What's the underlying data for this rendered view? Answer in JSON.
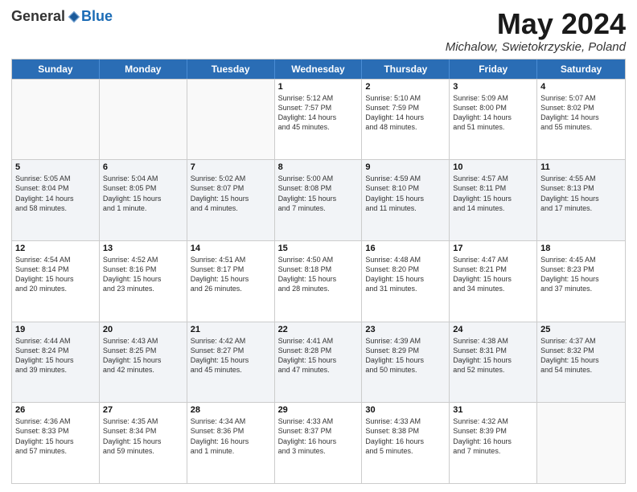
{
  "logo": {
    "general": "General",
    "blue": "Blue"
  },
  "header": {
    "month": "May 2024",
    "location": "Michalow, Swietokrzyskie, Poland"
  },
  "days": [
    "Sunday",
    "Monday",
    "Tuesday",
    "Wednesday",
    "Thursday",
    "Friday",
    "Saturday"
  ],
  "rows": [
    [
      {
        "day": "",
        "info": ""
      },
      {
        "day": "",
        "info": ""
      },
      {
        "day": "",
        "info": ""
      },
      {
        "day": "1",
        "info": "Sunrise: 5:12 AM\nSunset: 7:57 PM\nDaylight: 14 hours\nand 45 minutes."
      },
      {
        "day": "2",
        "info": "Sunrise: 5:10 AM\nSunset: 7:59 PM\nDaylight: 14 hours\nand 48 minutes."
      },
      {
        "day": "3",
        "info": "Sunrise: 5:09 AM\nSunset: 8:00 PM\nDaylight: 14 hours\nand 51 minutes."
      },
      {
        "day": "4",
        "info": "Sunrise: 5:07 AM\nSunset: 8:02 PM\nDaylight: 14 hours\nand 55 minutes."
      }
    ],
    [
      {
        "day": "5",
        "info": "Sunrise: 5:05 AM\nSunset: 8:04 PM\nDaylight: 14 hours\nand 58 minutes."
      },
      {
        "day": "6",
        "info": "Sunrise: 5:04 AM\nSunset: 8:05 PM\nDaylight: 15 hours\nand 1 minute."
      },
      {
        "day": "7",
        "info": "Sunrise: 5:02 AM\nSunset: 8:07 PM\nDaylight: 15 hours\nand 4 minutes."
      },
      {
        "day": "8",
        "info": "Sunrise: 5:00 AM\nSunset: 8:08 PM\nDaylight: 15 hours\nand 7 minutes."
      },
      {
        "day": "9",
        "info": "Sunrise: 4:59 AM\nSunset: 8:10 PM\nDaylight: 15 hours\nand 11 minutes."
      },
      {
        "day": "10",
        "info": "Sunrise: 4:57 AM\nSunset: 8:11 PM\nDaylight: 15 hours\nand 14 minutes."
      },
      {
        "day": "11",
        "info": "Sunrise: 4:55 AM\nSunset: 8:13 PM\nDaylight: 15 hours\nand 17 minutes."
      }
    ],
    [
      {
        "day": "12",
        "info": "Sunrise: 4:54 AM\nSunset: 8:14 PM\nDaylight: 15 hours\nand 20 minutes."
      },
      {
        "day": "13",
        "info": "Sunrise: 4:52 AM\nSunset: 8:16 PM\nDaylight: 15 hours\nand 23 minutes."
      },
      {
        "day": "14",
        "info": "Sunrise: 4:51 AM\nSunset: 8:17 PM\nDaylight: 15 hours\nand 26 minutes."
      },
      {
        "day": "15",
        "info": "Sunrise: 4:50 AM\nSunset: 8:18 PM\nDaylight: 15 hours\nand 28 minutes."
      },
      {
        "day": "16",
        "info": "Sunrise: 4:48 AM\nSunset: 8:20 PM\nDaylight: 15 hours\nand 31 minutes."
      },
      {
        "day": "17",
        "info": "Sunrise: 4:47 AM\nSunset: 8:21 PM\nDaylight: 15 hours\nand 34 minutes."
      },
      {
        "day": "18",
        "info": "Sunrise: 4:45 AM\nSunset: 8:23 PM\nDaylight: 15 hours\nand 37 minutes."
      }
    ],
    [
      {
        "day": "19",
        "info": "Sunrise: 4:44 AM\nSunset: 8:24 PM\nDaylight: 15 hours\nand 39 minutes."
      },
      {
        "day": "20",
        "info": "Sunrise: 4:43 AM\nSunset: 8:25 PM\nDaylight: 15 hours\nand 42 minutes."
      },
      {
        "day": "21",
        "info": "Sunrise: 4:42 AM\nSunset: 8:27 PM\nDaylight: 15 hours\nand 45 minutes."
      },
      {
        "day": "22",
        "info": "Sunrise: 4:41 AM\nSunset: 8:28 PM\nDaylight: 15 hours\nand 47 minutes."
      },
      {
        "day": "23",
        "info": "Sunrise: 4:39 AM\nSunset: 8:29 PM\nDaylight: 15 hours\nand 50 minutes."
      },
      {
        "day": "24",
        "info": "Sunrise: 4:38 AM\nSunset: 8:31 PM\nDaylight: 15 hours\nand 52 minutes."
      },
      {
        "day": "25",
        "info": "Sunrise: 4:37 AM\nSunset: 8:32 PM\nDaylight: 15 hours\nand 54 minutes."
      }
    ],
    [
      {
        "day": "26",
        "info": "Sunrise: 4:36 AM\nSunset: 8:33 PM\nDaylight: 15 hours\nand 57 minutes."
      },
      {
        "day": "27",
        "info": "Sunrise: 4:35 AM\nSunset: 8:34 PM\nDaylight: 15 hours\nand 59 minutes."
      },
      {
        "day": "28",
        "info": "Sunrise: 4:34 AM\nSunset: 8:36 PM\nDaylight: 16 hours\nand 1 minute."
      },
      {
        "day": "29",
        "info": "Sunrise: 4:33 AM\nSunset: 8:37 PM\nDaylight: 16 hours\nand 3 minutes."
      },
      {
        "day": "30",
        "info": "Sunrise: 4:33 AM\nSunset: 8:38 PM\nDaylight: 16 hours\nand 5 minutes."
      },
      {
        "day": "31",
        "info": "Sunrise: 4:32 AM\nSunset: 8:39 PM\nDaylight: 16 hours\nand 7 minutes."
      },
      {
        "day": "",
        "info": ""
      }
    ]
  ]
}
